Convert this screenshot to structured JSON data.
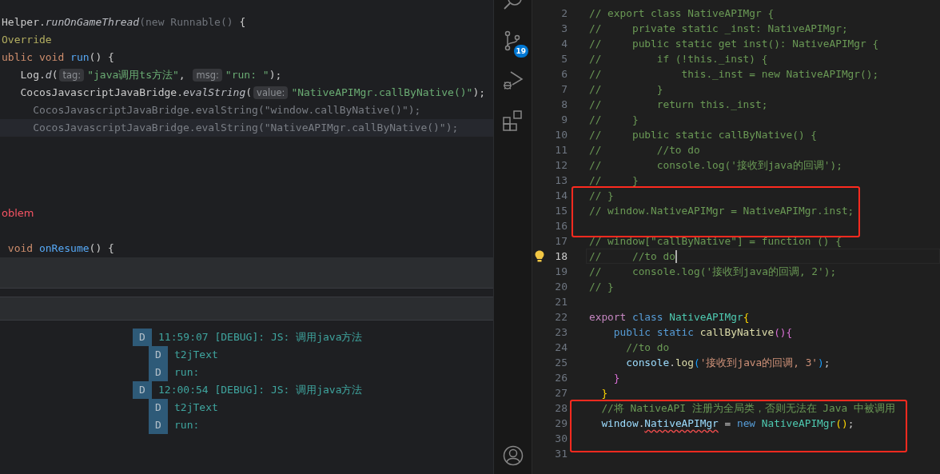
{
  "java_editor": {
    "lines": [
      {
        "current": false,
        "segments": [
          {
            "text": "Helper.",
            "kind": "plain"
          },
          {
            "text": "runOnGameThread",
            "kind": "italic"
          },
          {
            "text": "(new Runnable() ",
            "kind": "dim"
          },
          {
            "text": "{",
            "kind": "plain"
          }
        ]
      },
      {
        "current": false,
        "segments": [
          {
            "text": "Override",
            "kind": "annotation"
          }
        ]
      },
      {
        "current": false,
        "segments": [
          {
            "text": "ublic void ",
            "kind": "jkeyword"
          },
          {
            "text": "run",
            "kind": "jfunc"
          },
          {
            "text": "() {",
            "kind": "plain"
          }
        ]
      },
      {
        "current": false,
        "segments": [
          {
            "text": "   Log.",
            "kind": "plain"
          },
          {
            "text": "d",
            "kind": "italic"
          },
          {
            "text": "(",
            "kind": "plain"
          },
          {
            "text": "tag:",
            "kind": "hint"
          },
          {
            "text": "\"java调用ts方法\"",
            "kind": "jstring"
          },
          {
            "text": ", ",
            "kind": "plain"
          },
          {
            "text": "msg:",
            "kind": "hint"
          },
          {
            "text": "\"run: \"",
            "kind": "jstring"
          },
          {
            "text": ");",
            "kind": "plain"
          }
        ]
      },
      {
        "current": false,
        "segments": [
          {
            "text": "   CocosJavascriptJavaBridge.",
            "kind": "plain"
          },
          {
            "text": "evalString",
            "kind": "italic"
          },
          {
            "text": "(",
            "kind": "plain"
          },
          {
            "text": "value:",
            "kind": "hint"
          },
          {
            "text": "\"NativeAPIMgr.callByNative()\"",
            "kind": "jstring"
          },
          {
            "text": ");",
            "kind": "plain"
          }
        ]
      },
      {
        "current": false,
        "segments": [
          {
            "text": "     CocosJavascriptJavaBridge.evalString(\"window.callByNative()\");",
            "kind": "faded"
          }
        ]
      },
      {
        "current": true,
        "segments": [
          {
            "text": "     CocosJavascriptJavaBridge.evalString(\"NativeAPIMgr.callByNative()\");",
            "kind": "faded"
          }
        ]
      }
    ],
    "lower_lines": [
      {
        "current": false,
        "segments": [
          {
            "text": "oblem",
            "kind": "jerror"
          }
        ]
      },
      {
        "current": false,
        "segments": [
          {
            "text": " void ",
            "kind": "jkeyword"
          },
          {
            "text": "onResume",
            "kind": "jfunc"
          },
          {
            "text": "() {",
            "kind": "plain"
          }
        ]
      }
    ]
  },
  "log": {
    "entries": [
      {
        "level": "D",
        "text": "11:59:07 [DEBUG]: JS: 调用java方法",
        "children": [
          {
            "level": "D",
            "text": "t2jText"
          },
          {
            "level": "D",
            "text": "run:"
          }
        ]
      },
      {
        "level": "D",
        "text": "12:00:54 [DEBUG]: JS: 调用java方法",
        "children": [
          {
            "level": "D",
            "text": "t2jText"
          },
          {
            "level": "D",
            "text": "run:"
          }
        ]
      }
    ]
  },
  "activity_bar": {
    "scm_badge": "19"
  },
  "ts_editor": {
    "lines": [
      {
        "number": "2",
        "current": false,
        "segments": [
          {
            "text": "// export class NativeAPIMgr {",
            "kind": "comment"
          }
        ]
      },
      {
        "number": "3",
        "current": false,
        "segments": [
          {
            "text": "//     private static _inst: NativeAPIMgr;",
            "kind": "comment"
          }
        ]
      },
      {
        "number": "4",
        "current": false,
        "segments": [
          {
            "text": "//     public static get inst(): NativeAPIMgr {",
            "kind": "comment"
          }
        ]
      },
      {
        "number": "5",
        "current": false,
        "segments": [
          {
            "text": "//         if (!this._inst) {",
            "kind": "comment"
          }
        ]
      },
      {
        "number": "6",
        "current": false,
        "segments": [
          {
            "text": "//             this._inst = new NativeAPIMgr();",
            "kind": "comment"
          }
        ]
      },
      {
        "number": "7",
        "current": false,
        "segments": [
          {
            "text": "//         }",
            "kind": "comment"
          }
        ]
      },
      {
        "number": "8",
        "current": false,
        "segments": [
          {
            "text": "//         return this._inst;",
            "kind": "comment"
          }
        ]
      },
      {
        "number": "9",
        "current": false,
        "segments": [
          {
            "text": "//     }",
            "kind": "comment"
          }
        ]
      },
      {
        "number": "10",
        "current": false,
        "segments": [
          {
            "text": "//     public static callByNative() {",
            "kind": "comment"
          }
        ]
      },
      {
        "number": "11",
        "current": false,
        "segments": [
          {
            "text": "//         //to do",
            "kind": "comment"
          }
        ]
      },
      {
        "number": "12",
        "current": false,
        "segments": [
          {
            "text": "//         console.log('接收到java的回调');",
            "kind": "comment"
          }
        ]
      },
      {
        "number": "13",
        "current": false,
        "segments": [
          {
            "text": "//     }",
            "kind": "comment"
          }
        ]
      },
      {
        "number": "14",
        "current": false,
        "segments": [
          {
            "text": "// }",
            "kind": "comment"
          }
        ]
      },
      {
        "number": "15",
        "current": false,
        "segments": [
          {
            "text": "// window.NativeAPIMgr = NativeAPIMgr.inst;",
            "kind": "comment"
          }
        ]
      },
      {
        "number": "16",
        "current": false
      },
      {
        "number": "17",
        "current": false,
        "segments": [
          {
            "text": "// window[\"callByNative\"] = function () {",
            "kind": "comment"
          }
        ]
      },
      {
        "number": "18",
        "current": true,
        "segments": [
          {
            "text": "//     //to do",
            "kind": "comment"
          }
        ]
      },
      {
        "number": "19",
        "current": false,
        "segments": [
          {
            "text": "//     console.log('接收到java的回调, 2');",
            "kind": "comment"
          }
        ]
      },
      {
        "number": "20",
        "current": false,
        "segments": [
          {
            "text": "// }",
            "kind": "comment"
          }
        ]
      },
      {
        "number": "21",
        "current": false
      },
      {
        "number": "22",
        "current": false,
        "segments": [
          {
            "text": "export ",
            "kind": "control"
          },
          {
            "text": "class ",
            "kind": "keyword"
          },
          {
            "text": "NativeAPIMgr",
            "kind": "type"
          },
          {
            "text": "{",
            "kind": "bracket1"
          }
        ]
      },
      {
        "number": "23",
        "current": false,
        "segments": [
          {
            "text": "    public static ",
            "kind": "keyword"
          },
          {
            "text": "callByNative",
            "kind": "func"
          },
          {
            "text": "(){",
            "kind": "bracket2"
          }
        ]
      },
      {
        "number": "24",
        "current": false,
        "segments": [
          {
            "text": "      //to do",
            "kind": "comment"
          }
        ]
      },
      {
        "number": "25",
        "current": false,
        "segments": [
          {
            "text": "      console",
            "kind": "var"
          },
          {
            "text": ".",
            "kind": "plain"
          },
          {
            "text": "log",
            "kind": "func"
          },
          {
            "text": "(",
            "kind": "bracket3"
          },
          {
            "text": "'接收到java的回调, 3'",
            "kind": "string"
          },
          {
            "text": ")",
            "kind": "bracket3"
          },
          {
            "text": ";",
            "kind": "plain"
          }
        ]
      },
      {
        "number": "26",
        "current": false,
        "segments": [
          {
            "text": "    }",
            "kind": "bracket2"
          }
        ]
      },
      {
        "number": "27",
        "current": false,
        "segments": [
          {
            "text": "  }",
            "kind": "bracket1"
          }
        ]
      },
      {
        "number": "28",
        "current": false,
        "segments": [
          {
            "text": "  //将 NativeAPI 注册为全局类，否则无法在 Java 中被调用",
            "kind": "comment"
          }
        ]
      },
      {
        "number": "29",
        "current": false,
        "segments": [
          {
            "text": "  window",
            "kind": "var"
          },
          {
            "text": ".",
            "kind": "plain"
          },
          {
            "text": "NativeAPIMgr",
            "kind": "var-error"
          },
          {
            "text": " = ",
            "kind": "plain"
          },
          {
            "text": "new ",
            "kind": "keyword"
          },
          {
            "text": "NativeAPIMgr",
            "kind": "type"
          },
          {
            "text": "()",
            "kind": "bracket1"
          },
          {
            "text": ";",
            "kind": "plain"
          }
        ]
      },
      {
        "number": "30",
        "current": false
      },
      {
        "number": "31",
        "current": false
      }
    ]
  }
}
